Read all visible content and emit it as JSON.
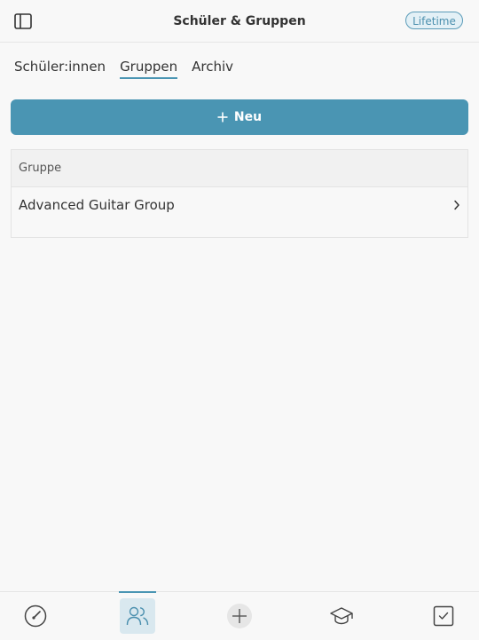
{
  "header": {
    "title": "Schüler & Gruppen",
    "badge": "Lifetime"
  },
  "tabs": [
    {
      "label": "Schüler:innen",
      "active": false
    },
    {
      "label": "Gruppen",
      "active": true
    },
    {
      "label": "Archiv",
      "active": false
    }
  ],
  "new_button": {
    "label": "Neu"
  },
  "table": {
    "column_header": "Gruppe",
    "rows": [
      {
        "name": "Advanced Guitar Group"
      }
    ]
  },
  "colors": {
    "accent": "#4a95b3",
    "accent_light": "#d9e8ef",
    "background": "#f8f8f8"
  },
  "tabbar": {
    "items": [
      {
        "icon": "gauge-icon",
        "active": false
      },
      {
        "icon": "users-icon",
        "active": true
      },
      {
        "icon": "add-icon",
        "active": false
      },
      {
        "icon": "graduation-cap-icon",
        "active": false
      },
      {
        "icon": "checkbox-icon",
        "active": false
      }
    ]
  }
}
